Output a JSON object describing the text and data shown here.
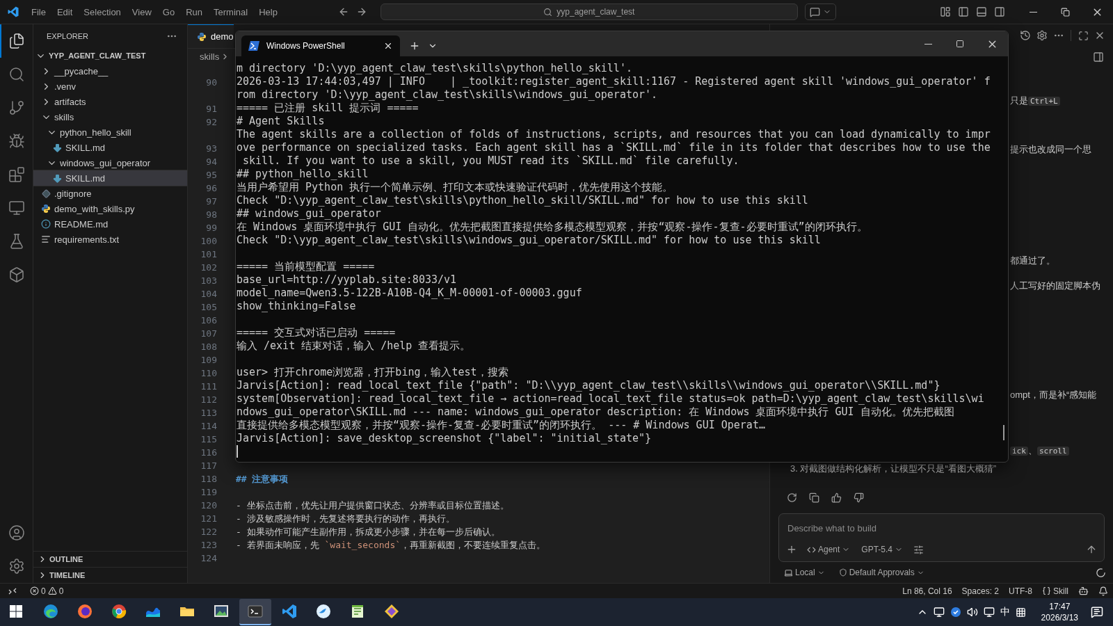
{
  "titlebar": {
    "menus": [
      "File",
      "Edit",
      "Selection",
      "View",
      "Go",
      "Run",
      "Terminal",
      "Help"
    ],
    "search": "yyp_agent_claw_test"
  },
  "activity_bar": {
    "top": [
      {
        "kind": "files",
        "selected": true
      },
      {
        "kind": "search",
        "selected": false
      },
      {
        "kind": "branch",
        "selected": false
      },
      {
        "kind": "debug",
        "selected": false
      },
      {
        "kind": "extensions",
        "selected": false
      },
      {
        "kind": "remote",
        "selected": false
      },
      {
        "kind": "testing",
        "selected": false
      },
      {
        "kind": "containers",
        "selected": false
      }
    ],
    "bottom": [
      {
        "kind": "account",
        "selected": false
      },
      {
        "kind": "settings",
        "selected": false
      }
    ]
  },
  "explorer": {
    "title": "EXPLORER",
    "tree": [
      {
        "label": "YYP_AGENT_CLAW_TEST",
        "kind": "folder",
        "expanded": true,
        "selected": false,
        "children": [
          {
            "label": "__pycache__",
            "kind": "folder",
            "expanded": false,
            "selected": false
          },
          {
            "label": ".venv",
            "kind": "folder",
            "expanded": false,
            "selected": false
          },
          {
            "label": "artifacts",
            "kind": "folder",
            "expanded": false,
            "selected": false
          },
          {
            "label": "skills",
            "kind": "folder",
            "expanded": true,
            "selected": false,
            "children": [
              {
                "label": "python_hello_skill",
                "kind": "folder",
                "expanded": true,
                "selected": false,
                "children": [
                  {
                    "label": "SKILL.md",
                    "kind": "markdown",
                    "selected": false
                  }
                ]
              },
              {
                "label": "windows_gui_operator",
                "kind": "folder",
                "expanded": true,
                "selected": false,
                "children": [
                  {
                    "label": "SKILL.md",
                    "kind": "markdown",
                    "selected": true
                  }
                ]
              }
            ]
          },
          {
            "label": ".gitignore",
            "kind": "git",
            "selected": false
          },
          {
            "label": "demo_with_skills.py",
            "kind": "python",
            "selected": false
          },
          {
            "label": "README.md",
            "kind": "info",
            "selected": false
          },
          {
            "label": "requirements.txt",
            "kind": "text",
            "selected": false
          }
        ]
      }
    ],
    "sections": [
      {
        "label": "OUTLINE",
        "expanded": false
      },
      {
        "label": "TIMELINE",
        "expanded": false
      }
    ]
  },
  "editor": {
    "tab": "demo",
    "breadcrumb": [
      "skills"
    ],
    "lines": [
      {
        "number": "90",
        "kind": "wrapped"
      },
      {
        "number": "91",
        "kind": "empty"
      },
      {
        "number": "92",
        "kind": "wrapped"
      },
      {
        "number": "93",
        "kind": "empty"
      },
      {
        "number": "94",
        "kind": "empty"
      },
      {
        "number": "95",
        "kind": "empty"
      },
      {
        "number": "96",
        "kind": "empty"
      },
      {
        "number": "97",
        "kind": "empty"
      },
      {
        "number": "98",
        "kind": "empty"
      },
      {
        "number": "99",
        "kind": "empty"
      },
      {
        "number": "100",
        "kind": "empty"
      },
      {
        "number": "101",
        "kind": "empty"
      },
      {
        "number": "102",
        "kind": "empty"
      },
      {
        "number": "103",
        "kind": "empty"
      },
      {
        "number": "104",
        "kind": "empty"
      },
      {
        "number": "105",
        "kind": "empty"
      },
      {
        "number": "106",
        "kind": "empty"
      },
      {
        "number": "107",
        "kind": "empty"
      },
      {
        "number": "108",
        "kind": "empty"
      },
      {
        "number": "109",
        "kind": "empty"
      },
      {
        "number": "110",
        "kind": "empty"
      },
      {
        "number": "111",
        "kind": "empty"
      },
      {
        "number": "112",
        "kind": "empty"
      },
      {
        "number": "113",
        "kind": "empty"
      },
      {
        "number": "114",
        "kind": "empty"
      },
      {
        "number": "115",
        "kind": "empty"
      },
      {
        "number": "116",
        "kind": "empty"
      },
      {
        "number": "117",
        "kind": "empty"
      },
      {
        "number": "118",
        "kind": "heading",
        "segments": [
          {
            "text": "## 注意事项",
            "kind": "plain"
          }
        ]
      },
      {
        "number": "119",
        "kind": "empty"
      },
      {
        "number": "120",
        "kind": "text",
        "segments": [
          {
            "text": "- 坐标点击前，优先让用户提供窗口状态、分辨率或目标位置描述。",
            "kind": "plain"
          }
        ]
      },
      {
        "number": "121",
        "kind": "text",
        "segments": [
          {
            "text": "- 涉及敏感操作时，先复述将要执行的动作，再执行。",
            "kind": "plain"
          }
        ]
      },
      {
        "number": "122",
        "kind": "text",
        "segments": [
          {
            "text": "- 如果动作可能产生副作用，拆成更小步骤，并在每一步后确认。",
            "kind": "plain"
          }
        ]
      },
      {
        "number": "123",
        "kind": "text",
        "segments": [
          {
            "text": "- 若界面未响应，先 ",
            "kind": "plain"
          },
          {
            "text": "`wait_seconds`",
            "kind": "code"
          },
          {
            "text": "，再重新截图，不要连续重复点击。",
            "kind": "plain"
          }
        ]
      },
      {
        "number": "124",
        "kind": "empty"
      }
    ]
  },
  "terminal": {
    "title": "Windows PowerShell",
    "lines": [
      {
        "kind": "text",
        "text": "m directory 'D:\\yyp_agent_claw_test\\skills\\python_hello_skill'."
      },
      {
        "kind": "text",
        "text": "2026-03-13 17:44:03,497 | INFO    | _toolkit:register_agent_skill:1167 - Registered agent skill 'windows_gui_operator' f"
      },
      {
        "kind": "text",
        "text": "rom directory 'D:\\yyp_agent_claw_test\\skills\\windows_gui_operator'."
      },
      {
        "kind": "text",
        "text": "===== 已注册 skill 提示词 ====="
      },
      {
        "kind": "text",
        "text": "# Agent Skills"
      },
      {
        "kind": "text",
        "text": "The agent skills are a collection of folds of instructions, scripts, and resources that you can load dynamically to impr"
      },
      {
        "kind": "text",
        "text": "ove performance on specialized tasks. Each agent skill has a `SKILL.md` file in its folder that describes how to use the"
      },
      {
        "kind": "text",
        "text": " skill. If you want to use a skill, you MUST read its `SKILL.md` file carefully."
      },
      {
        "kind": "text",
        "text": "## python_hello_skill"
      },
      {
        "kind": "text",
        "text": "当用户希望用 Python 执行一个简单示例、打印文本或快速验证代码时，优先使用这个技能。"
      },
      {
        "kind": "text",
        "text": "Check \"D:\\yyp_agent_claw_test\\skills\\python_hello_skill/SKILL.md\" for how to use this skill"
      },
      {
        "kind": "text",
        "text": "## windows_gui_operator"
      },
      {
        "kind": "text",
        "text": "在 Windows 桌面环境中执行 GUI 自动化。优先把截图直接提供给多模态模型观察，并按“观察-操作-复查-必要时重试”的闭环执行。"
      },
      {
        "kind": "text",
        "text": "Check \"D:\\yyp_agent_claw_test\\skills\\windows_gui_operator/SKILL.md\" for how to use this skill"
      },
      {
        "kind": "blank"
      },
      {
        "kind": "text",
        "text": "===== 当前模型配置 ====="
      },
      {
        "kind": "text",
        "text": "base_url=http://yyplab.site:8033/v1"
      },
      {
        "kind": "text",
        "text": "model_name=Qwen3.5-122B-A10B-Q4_K_M-00001-of-00003.gguf"
      },
      {
        "kind": "text",
        "text": "show_thinking=False"
      },
      {
        "kind": "blank"
      },
      {
        "kind": "text",
        "text": "===== 交互式对话已启动 ====="
      },
      {
        "kind": "text",
        "text": "输入 /exit 结束对话，输入 /help 查看提示。"
      },
      {
        "kind": "blank"
      },
      {
        "kind": "text",
        "text": "user> 打开chrome浏览器，打开bing，输入test，搜索"
      },
      {
        "kind": "text",
        "text": "Jarvis[Action]: read_local_text_file {\"path\": \"D:\\\\yyp_agent_claw_test\\\\skills\\\\windows_gui_operator\\\\SKILL.md\"}"
      },
      {
        "kind": "text",
        "text": "system[Observation]: read_local_text_file → action=read_local_text_file status=ok path=D:\\yyp_agent_claw_test\\skills\\wi"
      },
      {
        "kind": "text",
        "text": "ndows_gui_operator\\SKILL.md --- name: windows_gui_operator description: 在 Windows 桌面环境中执行 GUI 自动化。优先把截图"
      },
      {
        "kind": "text",
        "text": "直接提供给多模态模型观察，并按“观察-操作-复查-必要时重试”的闭环执行。 --- # Windows GUI Operat…"
      },
      {
        "kind": "text",
        "text": "Jarvis[Action]: save_desktop_screenshot {\"label\": \"initial_state\"}"
      }
    ]
  },
  "chat": {
    "fragments": [
      {
        "kind": "clipped",
        "segments": [
          {
            "text": "只是",
            "kind": "plain"
          },
          {
            "text": "Ctrl+L",
            "kind": "code"
          }
        ]
      },
      {
        "kind": "clipped",
        "segments": [
          {
            "text": "提示也改成同一个思",
            "kind": "plain"
          }
        ]
      },
      {
        "kind": "clipped",
        "segments": [
          {
            "text": "都通过了。",
            "kind": "plain"
          }
        ]
      },
      {
        "kind": "clipped",
        "segments": [
          {
            "text": "人工写好的固定脚本伪",
            "kind": "plain"
          }
        ]
      },
      {
        "kind": "clipped",
        "segments": [
          {
            "text": "ompt，而是补“感知能",
            "kind": "plain"
          }
        ]
      },
      {
        "kind": "clipped",
        "segments": [
          {
            "text": "ick",
            "kind": "code"
          },
          {
            "text": "、",
            "kind": "plain"
          },
          {
            "text": "scroll",
            "kind": "code"
          }
        ]
      },
      {
        "kind": "full",
        "segments": [
          {
            "text": "3. 对截图做结构化解析，让模型不只是“看图大概猜”",
            "kind": "plain"
          }
        ]
      }
    ],
    "input": {
      "placeholder": "Describe what to build",
      "mode": "Agent",
      "model": "GPT-5.4"
    },
    "footer": {
      "location": "Local",
      "approvals": "Default Approvals"
    }
  },
  "status_bar": {
    "errors": "0",
    "warnings": "0",
    "position": "Ln 86, Col 16",
    "indent": "Spaces: 2",
    "encoding": "UTF-8",
    "language": "Skill"
  },
  "taskbar": {
    "apps": [
      {
        "kind": "edge",
        "selected": false
      },
      {
        "kind": "firefox",
        "selected": false
      },
      {
        "kind": "chrome",
        "selected": false
      },
      {
        "kind": "wave",
        "selected": false
      },
      {
        "kind": "folder",
        "selected": false
      },
      {
        "kind": "image",
        "selected": false
      },
      {
        "kind": "terminal",
        "selected": true
      },
      {
        "kind": "vscode",
        "selected": false
      },
      {
        "kind": "bird",
        "selected": false
      },
      {
        "kind": "notepad",
        "selected": false
      },
      {
        "kind": "git",
        "selected": false
      }
    ],
    "ime": "中",
    "time": "17:47",
    "date": "2026/3/13"
  }
}
